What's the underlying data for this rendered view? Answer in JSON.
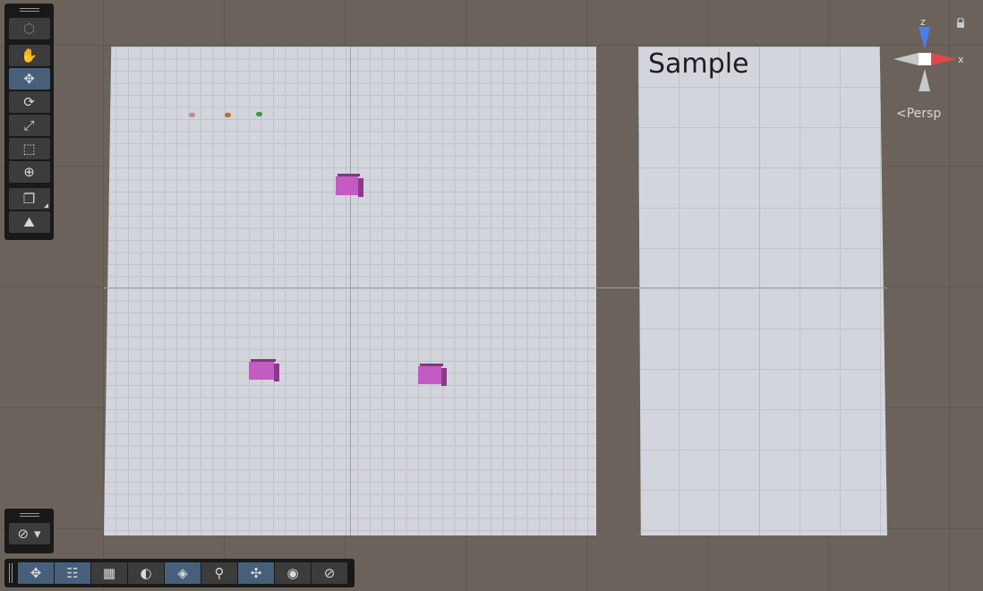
{
  "scene": {
    "overlay_text": "Sample"
  },
  "tools": {
    "items": [
      {
        "name": "view-mode",
        "glyph": "⬡",
        "state": "dim"
      },
      {
        "name": "hand-tool",
        "glyph": "✋",
        "state": "normal"
      },
      {
        "name": "move-tool",
        "glyph": "✥",
        "state": "active"
      },
      {
        "name": "rotate-tool",
        "glyph": "⟳",
        "state": "normal"
      },
      {
        "name": "scale-tool",
        "glyph": "⤢",
        "state": "normal"
      },
      {
        "name": "rect-tool",
        "glyph": "⬚",
        "state": "normal"
      },
      {
        "name": "transform-tool",
        "glyph": "⊕",
        "state": "normal"
      },
      {
        "name": "custom-tool",
        "glyph": "❐",
        "state": "normal"
      },
      {
        "name": "terrain-tool",
        "glyph": "⛰",
        "state": "normal"
      }
    ]
  },
  "camera": {
    "glyph": "⊘",
    "dropdown": "▾"
  },
  "overlays": {
    "items": [
      {
        "name": "transform",
        "glyph": "✥",
        "active": true
      },
      {
        "name": "tool-settings",
        "glyph": "☷",
        "active": true
      },
      {
        "name": "grid",
        "glyph": "▦",
        "active": false
      },
      {
        "name": "lighting",
        "glyph": "◐",
        "active": false
      },
      {
        "name": "snap",
        "glyph": "◈",
        "active": true
      },
      {
        "name": "search",
        "glyph": "⚲",
        "active": false
      },
      {
        "name": "gizmos",
        "glyph": "✣",
        "active": true
      },
      {
        "name": "view-visibility",
        "glyph": "◉",
        "active": false
      },
      {
        "name": "navigation",
        "glyph": "⊘",
        "active": false
      }
    ]
  },
  "gizmo": {
    "z_label": "z",
    "x_label": "x",
    "projection": "Persp",
    "colors": {
      "z": "#4a7ef0",
      "x": "#e04848",
      "neutral": "#c8c8c8"
    }
  },
  "colors": {
    "background": "#6b635b",
    "plane": "#d2d5db",
    "cube": "#c35bc3",
    "active_tool": "#46607c"
  }
}
